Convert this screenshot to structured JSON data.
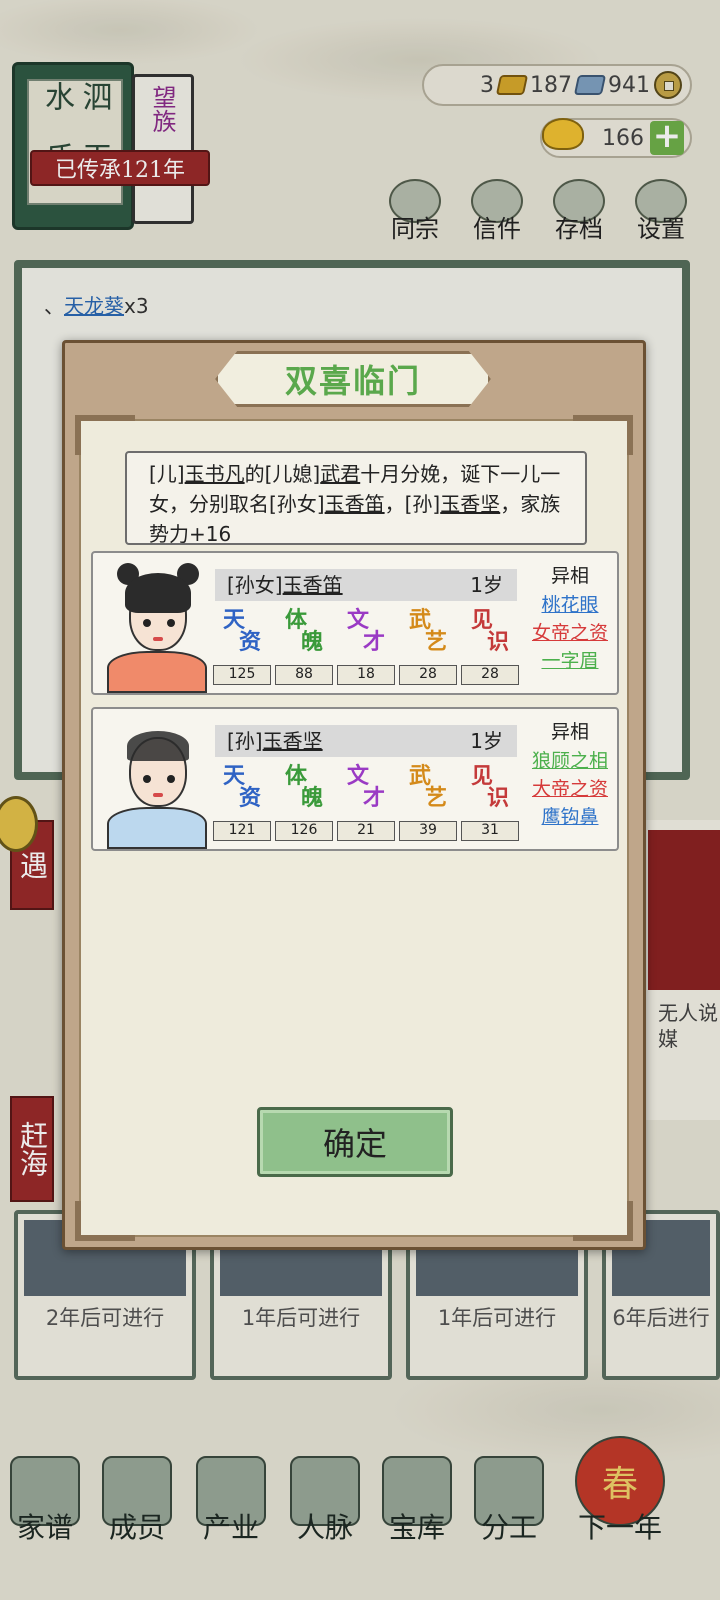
{
  "header": {
    "family_book": {
      "clan_name": "泗水",
      "surname": "玉氏",
      "rank": "望族",
      "inherit_text": "已传承121年"
    },
    "currency": [
      {
        "icon": "gold-bar-icon",
        "value": "3"
      },
      {
        "icon": "silver-bar-icon",
        "value": "187"
      },
      {
        "icon": "copper-coin-icon",
        "value": "941"
      }
    ],
    "gold_ingot": {
      "icon": "gold-ingot-icon",
      "value": "166"
    },
    "top_menu": [
      {
        "name": "clan",
        "label": "同宗",
        "icon": "clan-book-icon"
      },
      {
        "name": "letters",
        "label": "信件",
        "icon": "letter-icon"
      },
      {
        "name": "save",
        "label": "存档",
        "icon": "brush-icon"
      },
      {
        "name": "settings",
        "label": "设置",
        "icon": "gear-icon"
      }
    ]
  },
  "background": {
    "log_prefix": "、",
    "log_item": "天龙葵",
    "log_suffix": "x3",
    "side_tags": {
      "encounter": "遇",
      "sea": "赶海"
    },
    "right_card_text": "无人说媒",
    "event_cards": [
      {
        "text": "2年后可进行"
      },
      {
        "text": "1年后可进行"
      },
      {
        "text": "1年后可进行"
      },
      {
        "text": "6年后进行"
      }
    ]
  },
  "modal": {
    "title": "双喜临门",
    "message": {
      "p1": "[儿]",
      "father": "玉书凡",
      "p2": "的[儿媳]",
      "mother": "武君",
      "p3": "十月分娩，诞下一儿一女，分别取名[孙女]",
      "daughter": "玉香笛",
      "p4": "，[孙]",
      "son": "玉香坚",
      "p5": "，家族势力+16"
    },
    "stat_labels": [
      {
        "a": "天",
        "b": "资",
        "color": "#2f63c4"
      },
      {
        "a": "体",
        "b": "魄",
        "color": "#3a9a3a"
      },
      {
        "a": "文",
        "b": "才",
        "color": "#9a3ac4"
      },
      {
        "a": "武",
        "b": "艺",
        "color": "#d48a1a"
      },
      {
        "a": "见",
        "b": "识",
        "color": "#c43a3a"
      }
    ],
    "children": [
      {
        "role": "[孙女]",
        "name": "玉香笛",
        "age": "1岁",
        "stats": [
          "125",
          "88",
          "18",
          "28",
          "28"
        ],
        "traits_header": "异相",
        "traits": [
          {
            "text": "桃花眼",
            "color": "#2f73c9"
          },
          {
            "text": "女帝之资",
            "color": "#d63a3a"
          },
          {
            "text": "一字眉",
            "color": "#4cb04c"
          }
        ],
        "avatar_style": "girl"
      },
      {
        "role": "[孙]",
        "name": "玉香坚",
        "age": "1岁",
        "stats": [
          "121",
          "126",
          "21",
          "39",
          "31"
        ],
        "traits_header": "异相",
        "traits": [
          {
            "text": "狼顾之相",
            "color": "#4cb04c"
          },
          {
            "text": "大帝之资",
            "color": "#d63a3a"
          },
          {
            "text": "鹰钩鼻",
            "color": "#2f73c9"
          }
        ],
        "avatar_style": "boy"
      }
    ],
    "confirm_label": "确定"
  },
  "bottom_nav": [
    {
      "label": "家谱",
      "icon": "genealogy-book-icon"
    },
    {
      "label": "成员",
      "icon": "member-icon"
    },
    {
      "label": "产业",
      "icon": "building-icon"
    },
    {
      "label": "人脉",
      "icon": "network-icon"
    },
    {
      "label": "宝库",
      "icon": "treasure-chest-icon"
    },
    {
      "label": "分工",
      "icon": "scroll-icon"
    },
    {
      "label": "下一年",
      "icon": "lantern-icon",
      "lantern_char": "春"
    }
  ]
}
